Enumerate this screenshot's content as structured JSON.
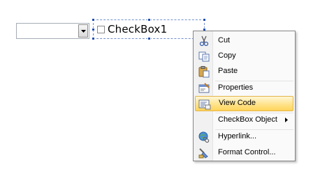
{
  "combo": {
    "value": ""
  },
  "checkbox": {
    "label": "CheckBox1"
  },
  "menu": {
    "cut": "Cut",
    "copy": "Copy",
    "paste": "Paste",
    "properties": "Properties",
    "view_code": "View Code",
    "checkbox_object": "CheckBox Object",
    "hyperlink": "Hyperlink...",
    "format_control": "Format Control..."
  },
  "icons": {
    "cut": "scissors-icon",
    "copy": "copy-icon",
    "paste": "paste-icon",
    "properties": "properties-icon",
    "view_code": "view-code-icon",
    "hyperlink": "hyperlink-icon",
    "format_control": "format-control-icon"
  },
  "colors": {
    "highlight": "#ffe38c",
    "selection_handle": "#1f4fae"
  }
}
